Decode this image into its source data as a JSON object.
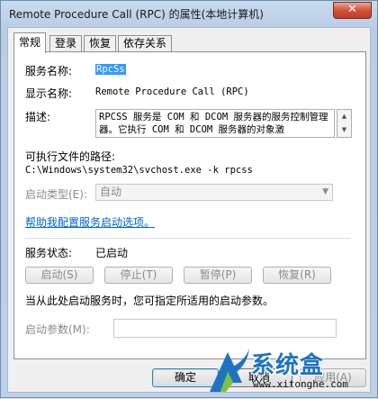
{
  "window": {
    "title": "Remote Procedure Call (RPC) 的属性(本地计算机)",
    "close_glyph": "✕"
  },
  "tabs": [
    {
      "label": "常规",
      "active": true
    },
    {
      "label": "登录",
      "active": false
    },
    {
      "label": "恢复",
      "active": false
    },
    {
      "label": "依存关系",
      "active": false
    }
  ],
  "general": {
    "service_name_label": "服务名称:",
    "service_name_value": "RpcSs",
    "display_name_label": "显示名称:",
    "display_name_value": "Remote Procedure Call (RPC)",
    "description_label": "描述:",
    "description_value": "RPCSS 服务是 COM 和 DCOM 服务器的服务控制管理器。它执行 COM 和 DCOM 服务器的对象激",
    "path_label": "可执行文件的路径:",
    "path_value": "C:\\Windows\\system32\\svchost.exe -k rpcss",
    "startup_type_label": "启动类型(E):",
    "startup_type_value": "自动",
    "help_link": "帮助我配置服务启动选项。",
    "status_label": "服务状态:",
    "status_value": "已启动",
    "buttons": {
      "start": "启动(S)",
      "stop": "停止(T)",
      "pause": "暂停(P)",
      "resume": "恢复(R)"
    },
    "hint": "当从此处启动服务时，您可指定所适用的启动参数。",
    "start_params_label": "启动参数(M):",
    "start_params_value": ""
  },
  "footer": {
    "ok": "确定",
    "cancel": "取消",
    "apply": "应用(A)"
  },
  "watermark": {
    "name": "系统盒",
    "url": "www.xitonghe.com"
  },
  "colors": {
    "link": "#0066cc",
    "selection": "#3399ff",
    "close": "#c23a22",
    "watermark": "#1e73be"
  }
}
